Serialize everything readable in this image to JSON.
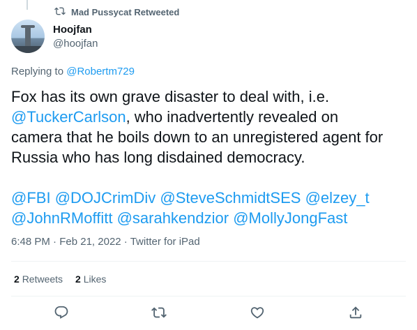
{
  "retweet": {
    "label": "Mad Pussycat Retweeted"
  },
  "author": {
    "name": "Hoojfan",
    "handle": "@hoojfan"
  },
  "reply": {
    "prefix": "Replying to ",
    "to": "@Robertm729"
  },
  "tweet": {
    "line1_pre": "Fox has its own grave disaster to deal with, i.e.",
    "mention1": "@TuckerCarlson",
    "line2_post": ", who inadvertently revealed on",
    "line3": "camera that he boils down to an unregistered agent for",
    "line4": "Russia who has long disdained democracy.",
    "tags1": [
      "@FBI",
      "@DOJCrimDiv",
      "@SteveSchmidtSES",
      "@elzey_t"
    ],
    "tags2": [
      "@JohnRMoffitt",
      "@sarahkendzior",
      "@MollyJongFast"
    ]
  },
  "meta": {
    "time": "6:48 PM",
    "sep": " · ",
    "date": "Feb 21, 2022",
    "source": "Twitter for iPad"
  },
  "stats": {
    "retweets_count": "2",
    "retweets_label": "Retweets",
    "likes_count": "2",
    "likes_label": "Likes"
  },
  "icons": {
    "retweet_header": "retweet-icon",
    "reply": "reply-icon",
    "retweet": "retweet-icon",
    "like": "heart-icon",
    "share": "share-icon"
  },
  "colors": {
    "link": "#1d9bf0",
    "muted": "#536471",
    "text": "#0f1419"
  }
}
